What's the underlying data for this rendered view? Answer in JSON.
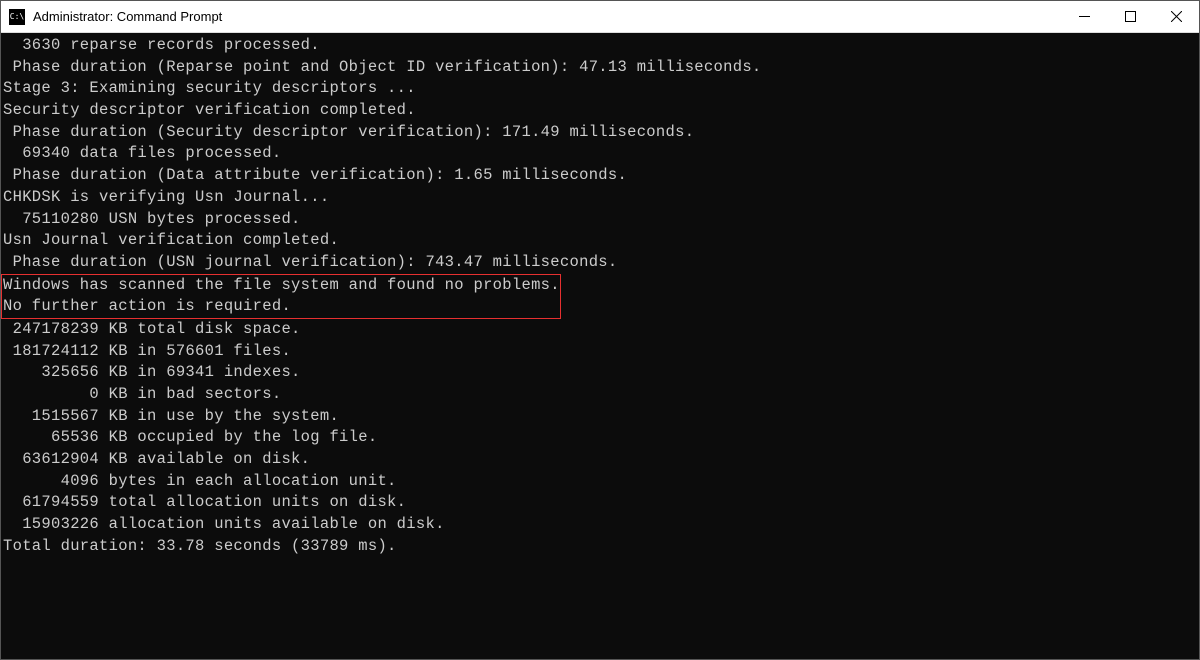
{
  "window": {
    "title": "Administrator: Command Prompt",
    "icon_label": "C:\\"
  },
  "terminal": {
    "lines": [
      "  3630 reparse records processed.",
      " Phase duration (Reparse point and Object ID verification): 47.13 milliseconds.",
      "",
      "Stage 3: Examining security descriptors ...",
      "Security descriptor verification completed.",
      " Phase duration (Security descriptor verification): 171.49 milliseconds.",
      "  69340 data files processed.",
      " Phase duration (Data attribute verification): 1.65 milliseconds.",
      "CHKDSK is verifying Usn Journal...",
      "  75110280 USN bytes processed.",
      "Usn Journal verification completed.",
      " Phase duration (USN journal verification): 743.47 milliseconds.",
      ""
    ],
    "highlighted": [
      "Windows has scanned the file system and found no problems.",
      "No further action is required."
    ],
    "lines_after": [
      "",
      " 247178239 KB total disk space.",
      " 181724112 KB in 576601 files.",
      "    325656 KB in 69341 indexes.",
      "         0 KB in bad sectors.",
      "   1515567 KB in use by the system.",
      "     65536 KB occupied by the log file.",
      "  63612904 KB available on disk.",
      "",
      "      4096 bytes in each allocation unit.",
      "  61794559 total allocation units on disk.",
      "  15903226 allocation units available on disk.",
      "Total duration: 33.78 seconds (33789 ms)."
    ]
  }
}
